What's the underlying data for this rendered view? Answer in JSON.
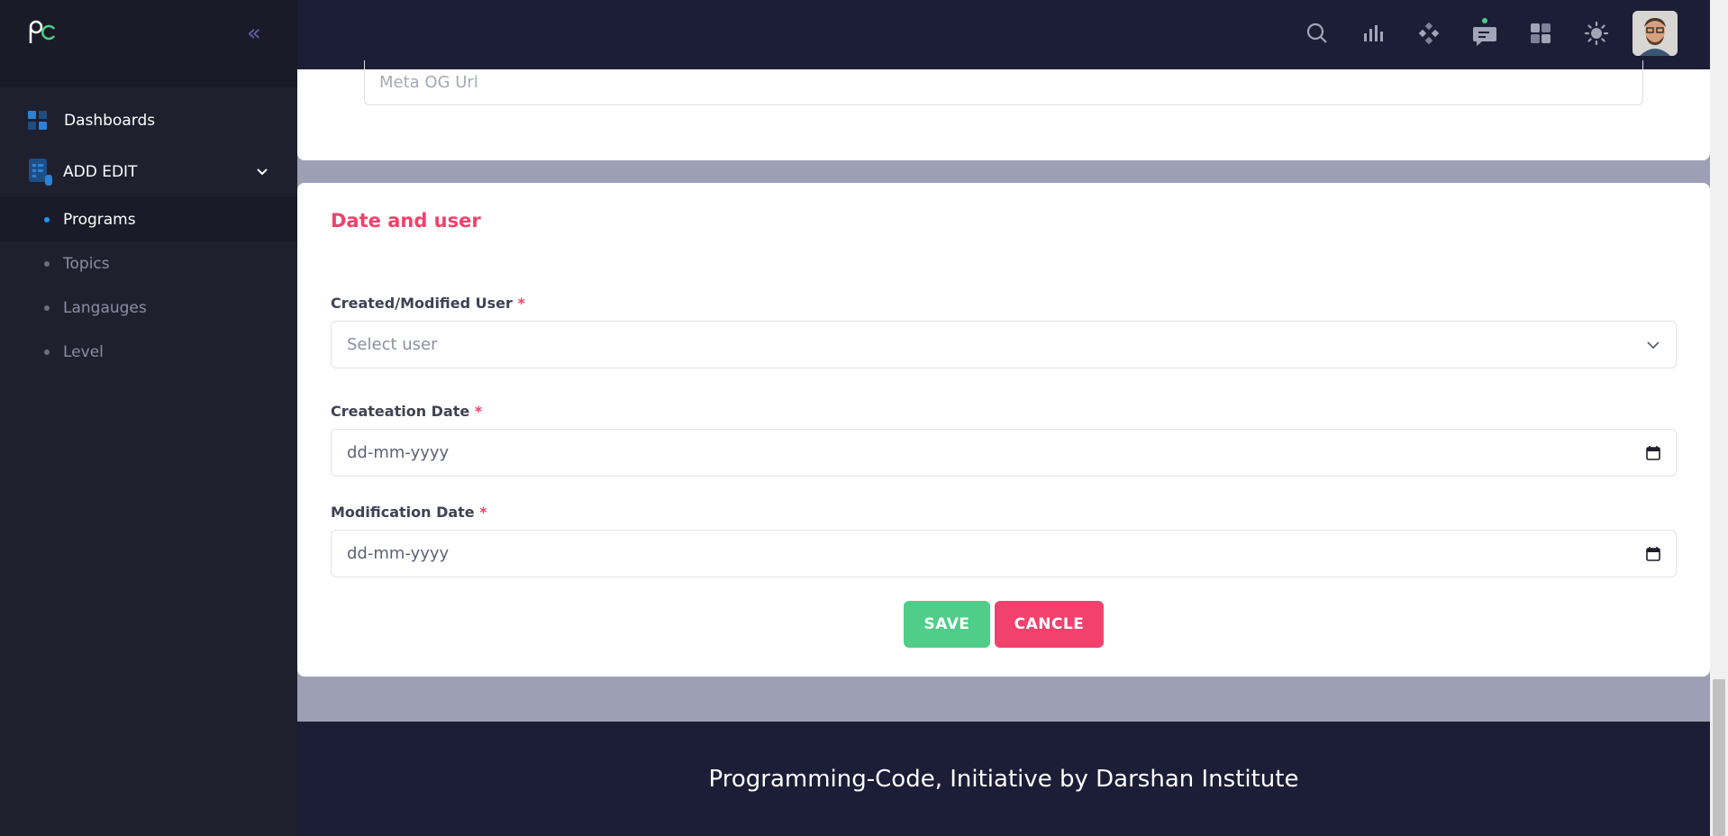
{
  "sidebar": {
    "collapse_glyph": "«",
    "items": [
      {
        "label": "Dashboards",
        "icon": "dashboard-grid-icon"
      },
      {
        "label": "ADD EDIT",
        "icon": "edit-document-icon",
        "expanded": true
      }
    ],
    "sub_items": [
      {
        "label": "Programs",
        "active": true
      },
      {
        "label": "Topics"
      },
      {
        "label": "Langauges"
      },
      {
        "label": "Level"
      }
    ]
  },
  "topbar": {
    "icons": [
      "search-icon",
      "bar-chart-icon",
      "apps-diamond-icon",
      "chat-icon",
      "grid-layout-icon",
      "sun-theme-icon"
    ],
    "notification_color": "#50cd89"
  },
  "form": {
    "meta_og_url_placeholder": "Meta OG Url",
    "section_title": "Date and user",
    "user_label": "Created/Modified User",
    "user_placeholder": "Select user",
    "creation_label": "Createation Date",
    "creation_value": "dd-mm-yyyy",
    "modification_label": "Modification Date",
    "modification_value": "dd-mm-yyyy",
    "required_mark": "*",
    "save_label": "SAVE",
    "cancel_label": "CANCLE"
  },
  "footer": {
    "text": "Programming-Code, Initiative by Darshan Institute"
  },
  "colors": {
    "accent_pink": "#f1416c",
    "success_green": "#50cd89",
    "sidebar_bg": "#1f1f2e",
    "topbar_bg": "#1c1d36"
  }
}
